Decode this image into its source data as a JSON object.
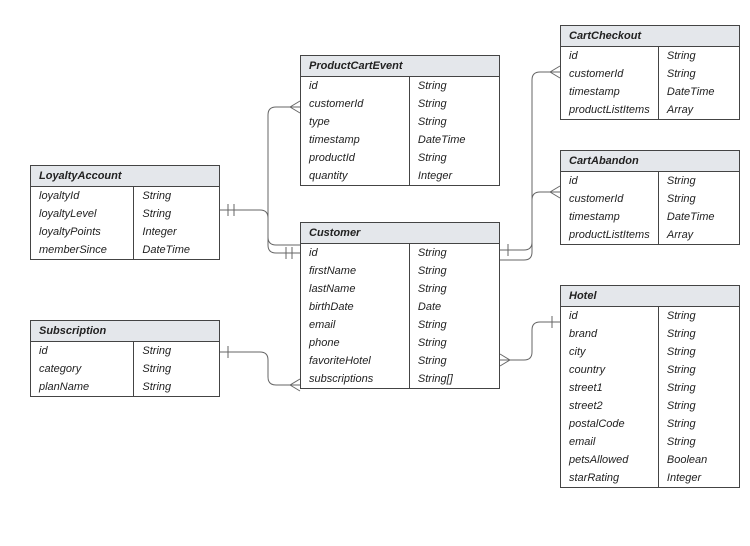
{
  "entities": {
    "productCartEvent": {
      "title": "ProductCartEvent",
      "attrs": [
        {
          "name": "id",
          "type": "String"
        },
        {
          "name": "customerId",
          "type": "String"
        },
        {
          "name": "type",
          "type": "String"
        },
        {
          "name": "timestamp",
          "type": "DateTime"
        },
        {
          "name": "productId",
          "type": "String"
        },
        {
          "name": "quantity",
          "type": "Integer"
        }
      ]
    },
    "loyaltyAccount": {
      "title": "LoyaltyAccount",
      "attrs": [
        {
          "name": "loyaltyId",
          "type": "String"
        },
        {
          "name": "loyaltyLevel",
          "type": "String"
        },
        {
          "name": "loyaltyPoints",
          "type": "Integer"
        },
        {
          "name": "memberSince",
          "type": "DateTime"
        }
      ]
    },
    "subscription": {
      "title": "Subscription",
      "attrs": [
        {
          "name": "id",
          "type": "String"
        },
        {
          "name": "category",
          "type": "String"
        },
        {
          "name": "planName",
          "type": "String"
        }
      ]
    },
    "customer": {
      "title": "Customer",
      "attrs": [
        {
          "name": "id",
          "type": "String"
        },
        {
          "name": "firstName",
          "type": "String"
        },
        {
          "name": "lastName",
          "type": "String"
        },
        {
          "name": "birthDate",
          "type": "Date"
        },
        {
          "name": "email",
          "type": "String"
        },
        {
          "name": "phone",
          "type": "String"
        },
        {
          "name": "favoriteHotel",
          "type": "String"
        },
        {
          "name": "subscriptions",
          "type": "String[]"
        }
      ]
    },
    "cartCheckout": {
      "title": "CartCheckout",
      "attrs": [
        {
          "name": "id",
          "type": "String"
        },
        {
          "name": "customerId",
          "type": "String"
        },
        {
          "name": "timestamp",
          "type": "DateTime"
        },
        {
          "name": "productListItems",
          "type": "Array"
        }
      ]
    },
    "cartAbandon": {
      "title": "CartAbandon",
      "attrs": [
        {
          "name": "id",
          "type": "String"
        },
        {
          "name": "customerId",
          "type": "String"
        },
        {
          "name": "timestamp",
          "type": "DateTime"
        },
        {
          "name": "productListItems",
          "type": "Array"
        }
      ]
    },
    "hotel": {
      "title": "Hotel",
      "attrs": [
        {
          "name": "id",
          "type": "String"
        },
        {
          "name": "brand",
          "type": "String"
        },
        {
          "name": "city",
          "type": "String"
        },
        {
          "name": "country",
          "type": "String"
        },
        {
          "name": "street1",
          "type": "String"
        },
        {
          "name": "street2",
          "type": "String"
        },
        {
          "name": "postalCode",
          "type": "String"
        },
        {
          "name": "email",
          "type": "String"
        },
        {
          "name": "petsAllowed",
          "type": "Boolean"
        },
        {
          "name": "starRating",
          "type": "Integer"
        }
      ]
    }
  },
  "relationships": [
    {
      "from": "LoyaltyAccount",
      "to": "Customer",
      "kind": "one-to-one"
    },
    {
      "from": "Customer",
      "to": "ProductCartEvent",
      "kind": "one-to-many"
    },
    {
      "from": "Customer",
      "to": "Subscription",
      "kind": "one-to-many"
    },
    {
      "from": "Customer",
      "to": "CartCheckout",
      "kind": "one-to-many"
    },
    {
      "from": "Customer",
      "to": "CartAbandon",
      "kind": "one-to-many"
    },
    {
      "from": "Customer",
      "to": "Hotel",
      "kind": "many-to-one"
    }
  ]
}
